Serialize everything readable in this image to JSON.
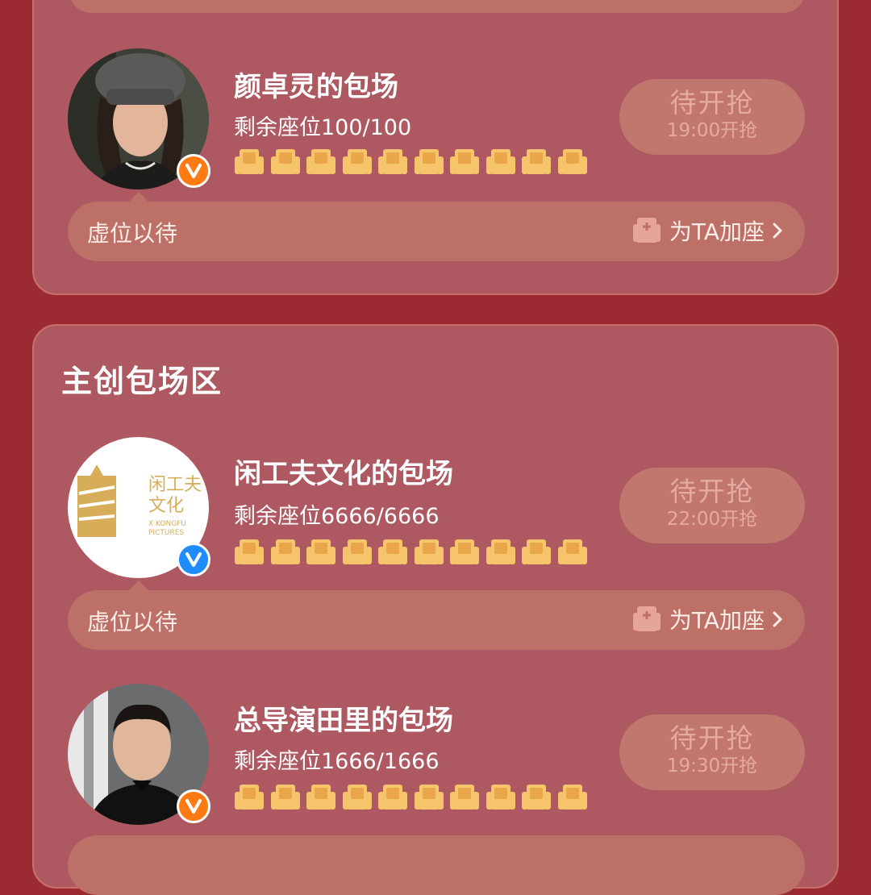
{
  "colors": {
    "background": "#9c2a33",
    "card": "#ae5861",
    "card_border": "#c9706b",
    "bar": "#bd7067",
    "button": "#c1766e",
    "button_text": "#e5aaa2",
    "seat": "#f6c46b",
    "badge_orange": "#ff7a12",
    "badge_blue": "#1e8cff"
  },
  "sections": [
    {
      "title": "",
      "entries": [
        {
          "name": "颜卓灵的包场",
          "seats_text": "剩余座位100/100",
          "seat_icon_count": 10,
          "button_label": "待开抢",
          "button_time": "19:00开抢",
          "bar_left": "虚位以待",
          "bar_right": "为TA加座",
          "badge": "orange"
        }
      ]
    },
    {
      "title": "主创包场区",
      "entries": [
        {
          "name": "闲工夫文化的包场",
          "seats_text": "剩余座位6666/6666",
          "seat_icon_count": 10,
          "button_label": "待开抢",
          "button_time": "22:00开抢",
          "bar_left": "虚位以待",
          "bar_right": "为TA加座",
          "badge": "blue",
          "logo": {
            "cn_line1": "闲工夫",
            "cn_line2": "文化",
            "en_line1": "X KONGFU",
            "en_line2": "PICTURES"
          }
        },
        {
          "name": "总导演田里的包场",
          "seats_text": "剩余座位1666/1666",
          "seat_icon_count": 10,
          "button_label": "待开抢",
          "button_time": "19:30开抢",
          "badge": "orange"
        }
      ]
    }
  ]
}
